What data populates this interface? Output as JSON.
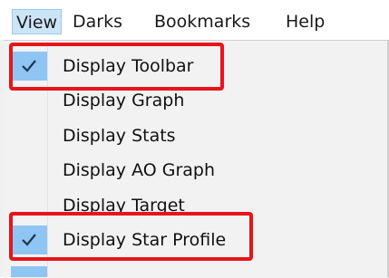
{
  "menubar": {
    "items": [
      {
        "label": "View",
        "active": true
      },
      {
        "label": "Darks",
        "active": false
      },
      {
        "label": "Bookmarks",
        "active": false
      },
      {
        "label": "Help",
        "active": false
      }
    ]
  },
  "view_menu": {
    "items": [
      {
        "label": "Display Toolbar",
        "checked": true,
        "highlighted": true
      },
      {
        "label": "Display Graph",
        "checked": false,
        "highlighted": false
      },
      {
        "label": "Display Stats",
        "checked": false,
        "highlighted": false
      },
      {
        "label": "Display AO Graph",
        "checked": false,
        "highlighted": false
      },
      {
        "label": "Display Target",
        "checked": false,
        "highlighted": false
      },
      {
        "label": "Display Star Profile",
        "checked": true,
        "highlighted": true
      }
    ]
  },
  "colors": {
    "check_background": "#8ec5f2",
    "highlight_border": "#e8141b",
    "active_menu": "#cce4f7"
  }
}
